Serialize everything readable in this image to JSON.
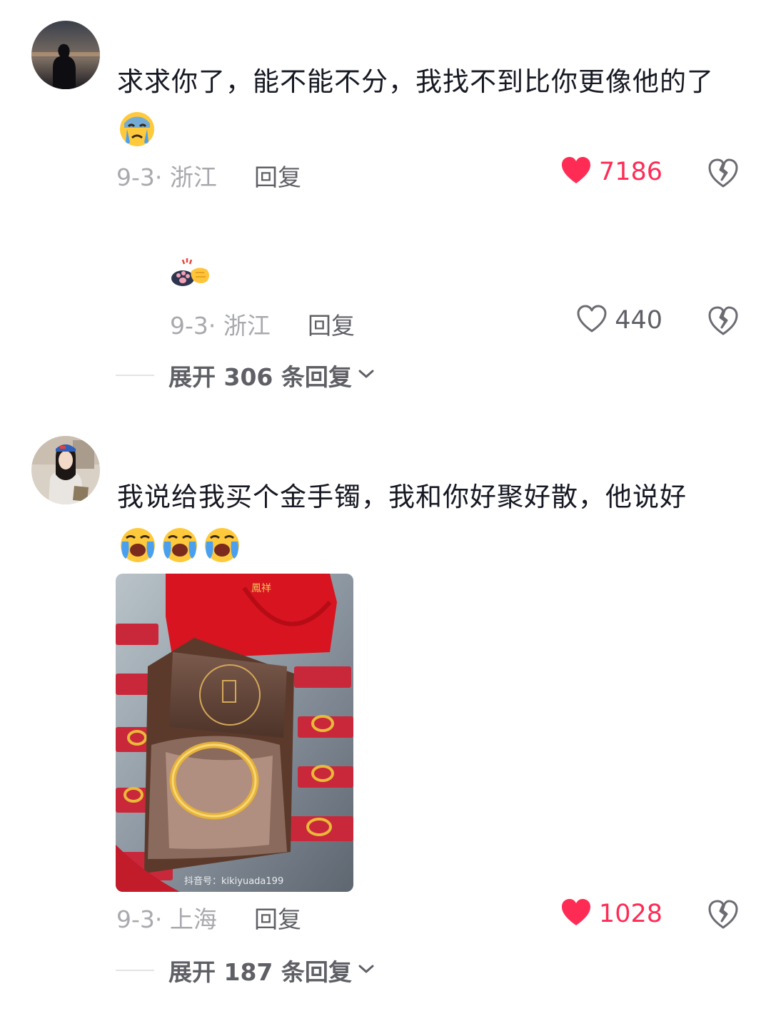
{
  "comments": [
    {
      "text_line1": "求求你了，能不能不分，我找不到比你更像他的了",
      "date": "9-3",
      "location": "浙江",
      "reply_label": "回复",
      "likes": "7186",
      "liked": true,
      "replies": [
        {
          "date": "9-3",
          "location": "浙江",
          "reply_label": "回复",
          "likes": "440",
          "liked": false
        }
      ],
      "expand_label": "展开 306 条回复"
    },
    {
      "text_line1": "我说给我买个金手镯，我和你好聚好散，他说好",
      "image_watermark": "抖音号：kikiyuada199",
      "date": "9-3",
      "location": "上海",
      "reply_label": "回复",
      "likes": "1028",
      "liked": true,
      "expand_label": "展开 187 条回复"
    }
  ],
  "icons": {
    "like_filled": "heart-filled-icon",
    "like_outline": "heart-outline-icon",
    "dislike": "broken-heart-icon",
    "expand": "chevron-down-icon",
    "emoji_cry": "crying-face-emoji",
    "emoji_bawl": "loudly-crying-face-emoji",
    "emoji_paw": "paw-fistbump-emoji"
  },
  "colors": {
    "like_red": "#fe2c55",
    "text_primary": "#161823",
    "text_meta": "#a8a9ae",
    "text_secondary": "#5f6066"
  }
}
